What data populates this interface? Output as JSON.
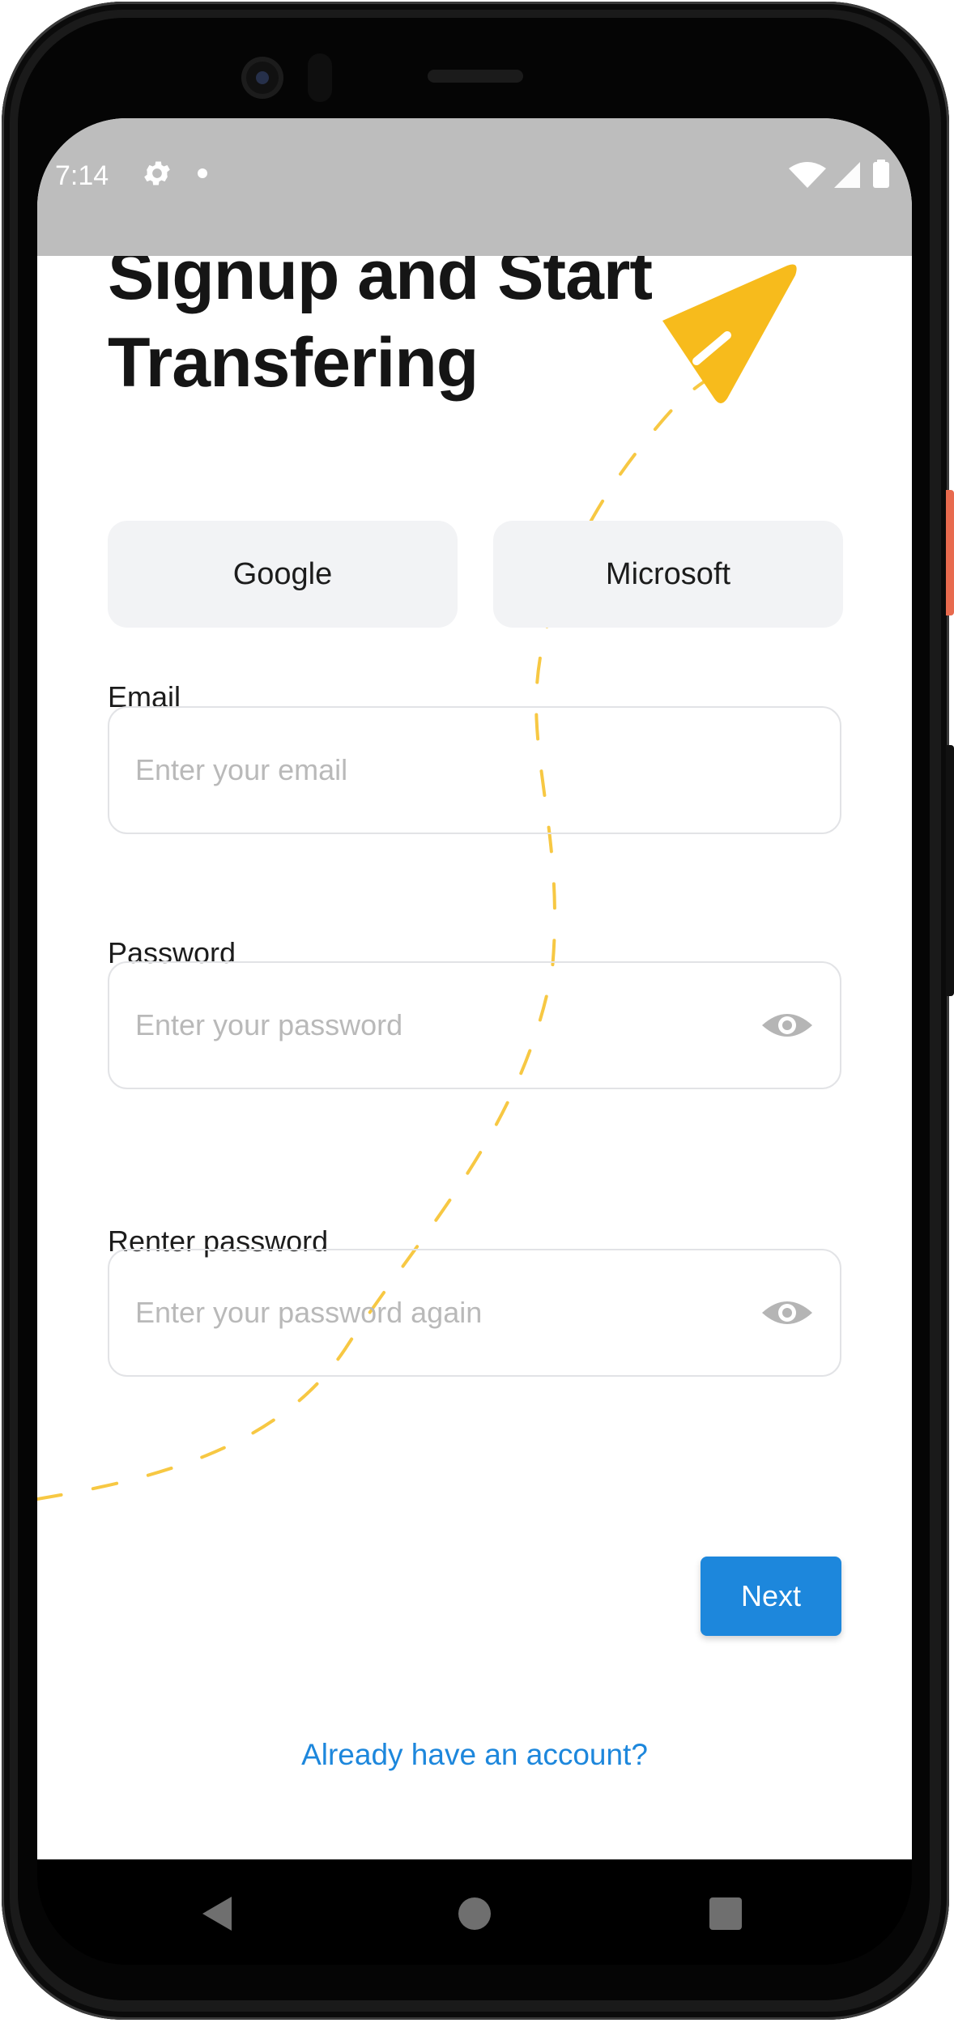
{
  "status_bar": {
    "time": "7:14",
    "icons": [
      "gear-icon",
      "notification-dot-icon",
      "wifi-icon",
      "signal-icon",
      "battery-icon"
    ]
  },
  "title": "Signup and Start Transfering",
  "social": {
    "google_label": "Google",
    "microsoft_label": "Microsoft"
  },
  "email": {
    "label": "Email",
    "placeholder": "Enter your email",
    "value": ""
  },
  "password": {
    "label": "Password",
    "placeholder": "Enter your password",
    "value": ""
  },
  "confirm_password": {
    "label": "Renter password",
    "placeholder": "Enter your password again",
    "value": ""
  },
  "next_label": "Next",
  "signin_link": "Already have an account?",
  "nav": {
    "icons": [
      "back-icon",
      "home-icon",
      "recents-icon"
    ]
  },
  "colors": {
    "accent": "#1d87dc",
    "plane": "#f7bb1c",
    "status_bar": "#bdbdbd",
    "input_border": "#e2e3e6",
    "social_bg": "#f2f3f5"
  }
}
